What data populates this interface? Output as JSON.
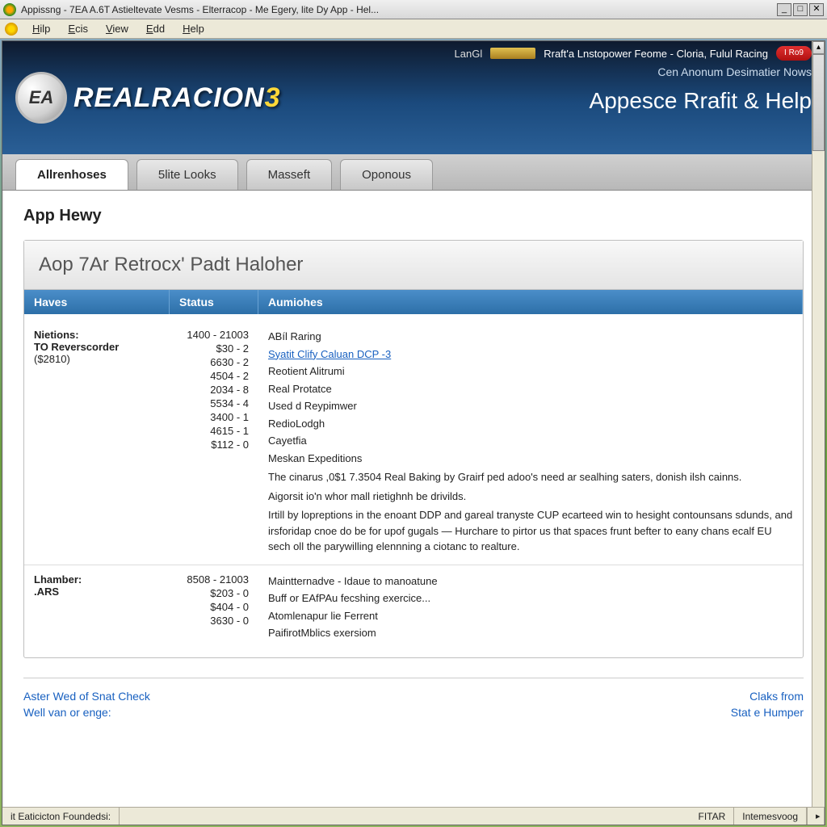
{
  "window": {
    "title": "Appissng - 7EA A.6T Astieltevate Vesms - Elterracop - Me Egery, lite Dy App - Hel..."
  },
  "menu": [
    "Hilp",
    "Ecis",
    "View",
    "Edd",
    "Help"
  ],
  "banner": {
    "top_prefix": "LanGl",
    "top_text": "Rraft'a Lnstopower Feome - Cloria, Fulul Racing",
    "badge": "I Ro9",
    "sub": "Cen Anonum Desimatier Nows",
    "headline": "Appesce Rrafit & Help",
    "logo_brand": "EA",
    "logo_word_white": "REALRACION",
    "logo_word_yellow": "3"
  },
  "tabs": [
    "Allrenhoses",
    "5lite Loоks",
    "Masseft",
    "Oponous"
  ],
  "page": {
    "title": "App Hewy",
    "card_title": "Aop 7Ar Retrocx' Padt Haloher",
    "columns": [
      "Haves",
      "Status",
      "Aumiohes"
    ],
    "sections": [
      {
        "labels": [
          "Nietions:",
          "TO Reverscorder",
          "($2810)"
        ],
        "status": [
          "1400 - 21003",
          "$30 - 2",
          "6630 - 2",
          "4504 - 2",
          "2034 - 8",
          "5534 - 4",
          "3400 - 1",
          "4615 - 1",
          "$112 - 0"
        ],
        "items": [
          {
            "text": "ABíl Raring"
          },
          {
            "text": "Syatit Clify Caluan DCP -3",
            "link": true
          },
          {
            "text": "Reotient Alitrumi"
          },
          {
            "text": "Real Protatce"
          },
          {
            "text": "Used d Reypimwer"
          },
          {
            "text": "RedioLodgh"
          },
          {
            "text": "Cayetfia"
          },
          {
            "text": "Meskan Expeditions"
          }
        ],
        "paras": [
          "The cinarus ,0$1 7.3504 Real Baking by Grairf ped adoo's need ar sealhing saters, donish ilsh cainns.",
          "Aigorsit io'n whor mall rietighnh be drivilds.",
          "Irtill by lopreptions in the enoant DDP and gareal tranyste CUP ecarteed win to hesight contounsans sdunds, and irsforidap cnoe do be for upof gugals — Hurchare to pirtor us that spaces frunt befter to eany chans ecalf EU sech oll the parywilling elennning a ciotanc to realture."
        ]
      },
      {
        "labels": [
          "Lhamber:",
          ".ARS"
        ],
        "status": [
          "8508 - 21003",
          "$203 - 0",
          "$404 - 0",
          "3630 - 0"
        ],
        "items": [
          {
            "text": "Maintternadve - Idaue to manoatune"
          },
          {
            "text": "Buff or EAfPAu fecshing exercice..."
          },
          {
            "text": "Atomlenapur lie Ferrent"
          },
          {
            "text": "PaifirotMblics exersiom"
          }
        ],
        "paras": []
      }
    ],
    "footer_left": [
      "Aster Wed of Snat Check",
      "Well van or enge:"
    ],
    "footer_right": [
      "Claks from",
      "Stat e Humper"
    ]
  },
  "status": {
    "left": "it Eaticicton Foundedsi:",
    "right1": "FITAR",
    "right2": "Intemesvoog"
  }
}
